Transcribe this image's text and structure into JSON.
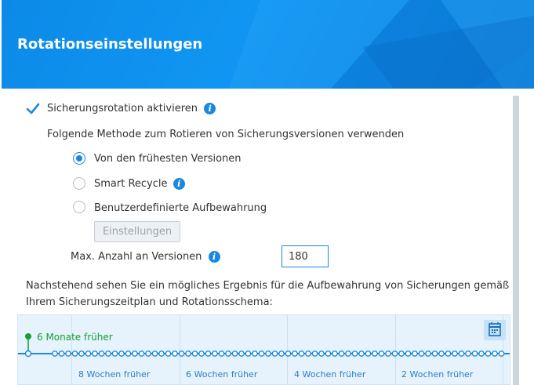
{
  "header": {
    "title": "Rotationseinstellungen"
  },
  "rotation": {
    "enable_label": "Sicherungsrotation aktivieren",
    "enabled": true,
    "method_label": "Folgende Methode zum Rotieren von Sicherungsversionen verwenden",
    "options": [
      {
        "label": "Von den frühesten Versionen",
        "selected": true
      },
      {
        "label": "Smart Recycle",
        "selected": false
      },
      {
        "label": "Benutzerdefinierte Aufbewahrung",
        "selected": false
      }
    ],
    "settings_button": "Einstellungen",
    "max_versions_label": "Max. Anzahl an Versionen",
    "max_versions_value": "180"
  },
  "description": "Nachstehend sehen Sie ein mögliches Ergebnis für die Aufbewahrung von Sicherungen gemäß Ihrem Sicherungszeitplan und Rotationsschema:",
  "timeline": {
    "start_label": "6 Monate früher",
    "week_labels": [
      "8 Wochen früher",
      "6 Wochen früher",
      "4 Wochen früher",
      "2 Wochen früher"
    ]
  },
  "colors": {
    "accent": "#1a88e0",
    "timeline_bg": "#e7f3fc",
    "start_marker": "#10a030"
  },
  "icons": [
    "checkmark-icon",
    "info-icon",
    "calendar-icon"
  ]
}
